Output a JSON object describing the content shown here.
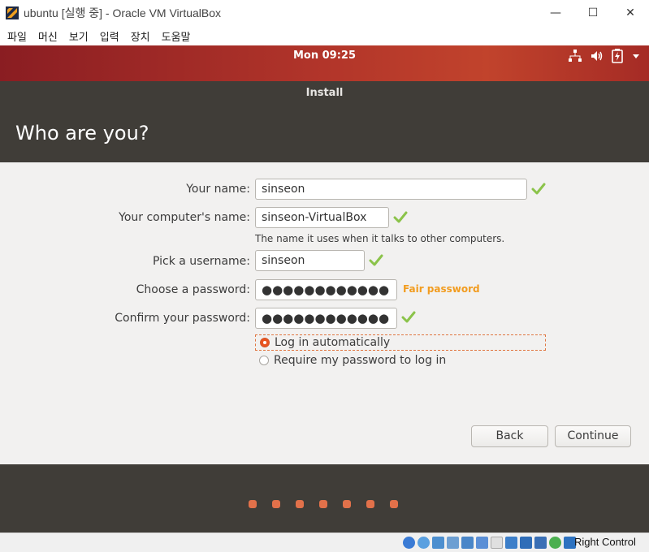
{
  "window": {
    "title": "ubuntu [실행 중] - Oracle VM VirtualBox",
    "minimize_glyph": "—",
    "maximize_glyph": "☐",
    "close_glyph": "✕"
  },
  "menu": [
    "파일",
    "머신",
    "보기",
    "입력",
    "장치",
    "도움말"
  ],
  "topbar": {
    "clock": "Mon 09:25",
    "icons": [
      "network-icon",
      "volume-icon",
      "battery-icon",
      "menu-arrow-icon"
    ]
  },
  "installer": {
    "title": "Install",
    "heading": "Who are you?",
    "fields": {
      "name": {
        "label": "Your name:",
        "value": "sinseon"
      },
      "computer": {
        "label": "Your computer's name:",
        "value": "sinseon-VirtualBox",
        "hint": "The name it uses when it talks to other computers."
      },
      "username": {
        "label": "Pick a username:",
        "value": "sinseon"
      },
      "password": {
        "label": "Choose a password:",
        "value": "●●●●●●●●●●●●",
        "strength": "Fair password"
      },
      "confirm": {
        "label": "Confirm your password:",
        "value": "●●●●●●●●●●●●"
      }
    },
    "login_options": {
      "auto": "Log in automatically",
      "require": "Require my password to log in",
      "selected": "auto"
    },
    "buttons": {
      "back": "Back",
      "continue": "Continue"
    },
    "progress_steps": 7
  },
  "statusbar": {
    "host_key": "Right Control"
  },
  "colors": {
    "accent": "#e95420",
    "check": "#8bc34a",
    "strength": "#f29c1f",
    "header": "#403d38"
  }
}
